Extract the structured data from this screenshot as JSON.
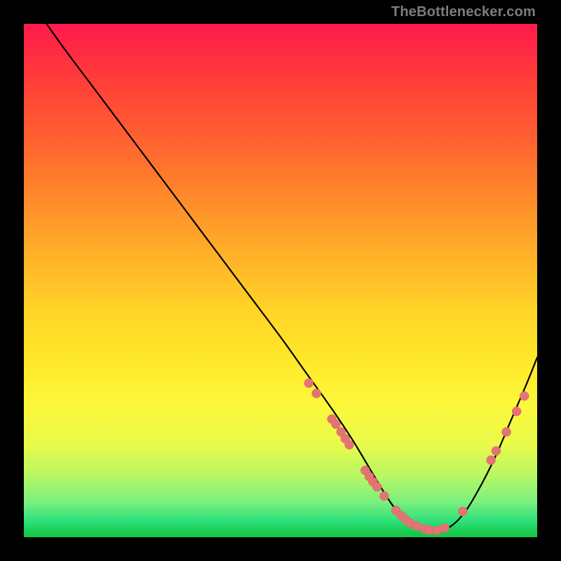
{
  "source_label": "TheBottlenecker.com",
  "colors": {
    "curve": "#000000",
    "marker_fill": "#e57373",
    "marker_stroke": "#d46a6a",
    "bg_black": "#000000",
    "label": "#7d7d7d"
  },
  "chart_data": {
    "type": "line",
    "title": "",
    "xlabel": "",
    "ylabel": "",
    "xlim": [
      0,
      100
    ],
    "ylim": [
      0,
      100
    ],
    "x": [
      0,
      3,
      8,
      14,
      20,
      26,
      32,
      38,
      44,
      50,
      55,
      60,
      64,
      67,
      70,
      72,
      74,
      76,
      78,
      80,
      83,
      86,
      89,
      92,
      95,
      98,
      100
    ],
    "y": [
      106,
      102,
      95,
      87,
      79,
      71,
      63,
      55,
      47,
      39,
      32,
      25,
      19,
      14,
      9,
      6,
      4,
      2.5,
      1.5,
      1.2,
      2,
      5,
      10,
      16,
      23,
      30,
      35
    ],
    "markers": [
      {
        "x": 55.5,
        "y": 30
      },
      {
        "x": 57.0,
        "y": 28
      },
      {
        "x": 60.0,
        "y": 23
      },
      {
        "x": 60.8,
        "y": 22
      },
      {
        "x": 61.8,
        "y": 20.5
      },
      {
        "x": 62.6,
        "y": 19.2
      },
      {
        "x": 63.4,
        "y": 18
      },
      {
        "x": 66.5,
        "y": 13
      },
      {
        "x": 67.3,
        "y": 11.8
      },
      {
        "x": 68.0,
        "y": 10.8
      },
      {
        "x": 68.8,
        "y": 9.8
      },
      {
        "x": 70.2,
        "y": 8
      },
      {
        "x": 72.5,
        "y": 5.2
      },
      {
        "x": 73.5,
        "y": 4.2
      },
      {
        "x": 74.3,
        "y": 3.5
      },
      {
        "x": 75.2,
        "y": 2.8
      },
      {
        "x": 76.5,
        "y": 2.2
      },
      {
        "x": 78.0,
        "y": 1.6
      },
      {
        "x": 79.0,
        "y": 1.4
      },
      {
        "x": 80.5,
        "y": 1.3
      },
      {
        "x": 82.0,
        "y": 1.8
      },
      {
        "x": 85.5,
        "y": 5.0
      },
      {
        "x": 91.0,
        "y": 15
      },
      {
        "x": 92.0,
        "y": 16.8
      },
      {
        "x": 94.0,
        "y": 20.5
      },
      {
        "x": 96.0,
        "y": 24.5
      },
      {
        "x": 97.5,
        "y": 27.5
      }
    ]
  }
}
